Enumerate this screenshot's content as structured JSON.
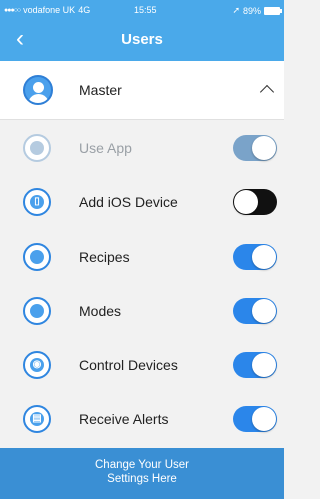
{
  "status_bar": {
    "carrier": "vodafone UK",
    "network": "4G",
    "time": "15:55",
    "battery": "89%"
  },
  "nav": {
    "back_icon": "back-chevron-icon",
    "title": "Users"
  },
  "master": {
    "label": "Master",
    "icon": "user-avatar-icon",
    "expanded": true
  },
  "settings": [
    {
      "label": "Use App",
      "icon": "use-app-icon",
      "enabled": true,
      "disabled": true
    },
    {
      "label": "Add iOS Device",
      "icon": "add-ios-device-icon",
      "enabled": false,
      "disabled": false
    },
    {
      "label": "Recipes",
      "icon": "recipes-icon",
      "enabled": true,
      "disabled": false
    },
    {
      "label": "Modes",
      "icon": "modes-icon",
      "enabled": true,
      "disabled": false
    },
    {
      "label": "Control Devices",
      "icon": "control-devices-icon",
      "enabled": true,
      "disabled": false
    },
    {
      "label": "Receive Alerts",
      "icon": "receive-alerts-icon",
      "enabled": true,
      "disabled": false
    }
  ],
  "footer": {
    "line1": "Change Your User",
    "line2": "Settings Here"
  },
  "colors": {
    "accent": "#4aa9ea",
    "toggle_on": "#2b86ea",
    "footer": "#3a8fd4"
  }
}
